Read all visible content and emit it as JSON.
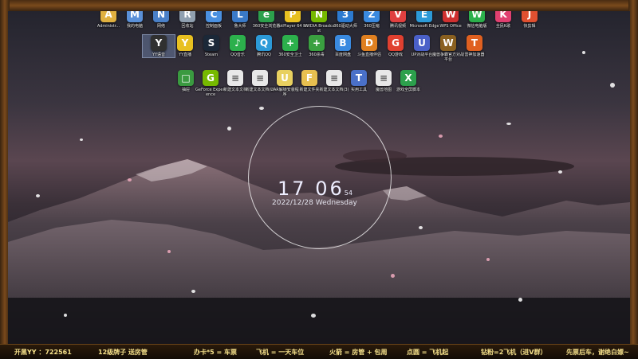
{
  "desktop_icons": [
    {
      "label": "Administr...",
      "glyph": "A",
      "color": "#e0b040"
    },
    {
      "label": "我的电脑",
      "glyph": "M",
      "color": "#5a90d8"
    },
    {
      "label": "网络",
      "glyph": "N",
      "color": "#4a80c8"
    },
    {
      "label": "回收站",
      "glyph": "R",
      "color": "#90a0b0"
    },
    {
      "label": "控制面板",
      "glyph": "C",
      "color": "#4a90e0"
    },
    {
      "label": "鲁大师",
      "glyph": "L",
      "color": "#3a7ac8"
    },
    {
      "label": "360安全浏览器",
      "glyph": "e",
      "color": "#2ca04c"
    },
    {
      "label": "PotPlayer 64 bit",
      "glyph": "P",
      "color": "#e8c020"
    },
    {
      "label": "NVIDIA Broadcast",
      "glyph": "N",
      "color": "#76b900"
    },
    {
      "label": "360驱动大师",
      "glyph": "3",
      "color": "#2c7ad0"
    },
    {
      "label": "360压缩",
      "glyph": "Z",
      "color": "#3a8ae0"
    },
    {
      "label": "腾讯视频",
      "glyph": "V",
      "color": "#e04040"
    },
    {
      "label": "Microsoft Edge",
      "glyph": "E",
      "color": "#2c9ad8"
    },
    {
      "label": "WPS Office",
      "glyph": "W",
      "color": "#d03030"
    },
    {
      "label": "微信电脑版",
      "glyph": "W",
      "color": "#2cb04c"
    },
    {
      "label": "全民K歌",
      "glyph": "K",
      "color": "#e04070"
    },
    {
      "label": "快剪辑",
      "glyph": "J",
      "color": "#e05030"
    },
    {
      "label": "YY语音",
      "glyph": "Y",
      "color": "#303030"
    },
    {
      "label": "YY直播",
      "glyph": "Y",
      "color": "#e8c020"
    },
    {
      "label": "Steam",
      "glyph": "S",
      "color": "#1b2838"
    },
    {
      "label": "QQ音乐",
      "glyph": "♪",
      "color": "#2cb04c"
    },
    {
      "label": "腾讯QQ",
      "glyph": "Q",
      "color": "#2c9ad8"
    },
    {
      "label": "360安全卫士",
      "glyph": "+",
      "color": "#2cb04c"
    },
    {
      "label": "360杀毒",
      "glyph": "+",
      "color": "#3aa040"
    },
    {
      "label": "百度网盘",
      "glyph": "B",
      "color": "#3a8ae0"
    },
    {
      "label": "斗鱼直播伴侣",
      "glyph": "D",
      "color": "#e08020"
    },
    {
      "label": "QQ游戏",
      "glyph": "G",
      "color": "#e04030"
    },
    {
      "label": "UP对战平台",
      "glyph": "U",
      "color": "#4a60c8"
    },
    {
      "label": "魔兽争霸官方对战平台",
      "glyph": "W",
      "color": "#8a6020"
    },
    {
      "label": "雷神加速器",
      "glyph": "T",
      "color": "#e06020"
    },
    {
      "label": "抽屉",
      "glyph": "□",
      "color": "#3a9a40"
    },
    {
      "label": "GeForce Experience",
      "glyph": "G",
      "color": "#76b900"
    },
    {
      "label": "新建文本文档",
      "glyph": "≡",
      "color": "#e8e8e8"
    },
    {
      "label": "新建文本文档(2)",
      "glyph": "≡",
      "color": "#e8e8e8"
    },
    {
      "label": "UAR解锁安装程序",
      "glyph": "U",
      "color": "#e8d060"
    },
    {
      "label": "新建文件夹",
      "glyph": "F",
      "color": "#e8c050"
    },
    {
      "label": "新建文本文档(3)",
      "glyph": "≡",
      "color": "#e8e8e8"
    },
    {
      "label": "实用工具",
      "glyph": "T",
      "color": "#4a70c8"
    },
    {
      "label": "魔兽地图",
      "glyph": "≡",
      "color": "#e8e8e8"
    },
    {
      "label": "游戏全屏脚本",
      "glyph": "X",
      "color": "#2ca04c"
    }
  ],
  "clock": {
    "hour": "17",
    "minute": "06",
    "second": "54",
    "date": "2022/12/28 Wednesday"
  },
  "ticker": [
    {
      "label": "开黑YY ：722561"
    },
    {
      "label": "12级牌子 送房管"
    },
    {
      "label": "办卡*5 = 车票"
    },
    {
      "label": "飞机 = 一天车位"
    },
    {
      "label": "火箭 = 房管 + 包周"
    },
    {
      "label": "点圆 = 飞机起"
    },
    {
      "label": "钻粉=2飞机（进V群）"
    },
    {
      "label": "先票后车，谢绝白嫖~"
    }
  ]
}
